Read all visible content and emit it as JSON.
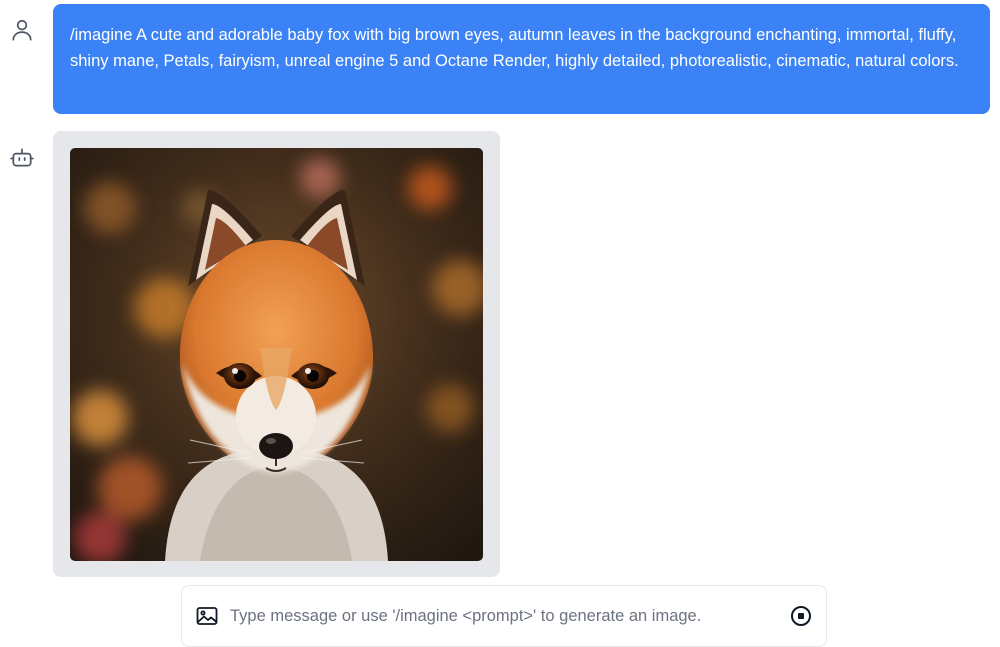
{
  "conversation": {
    "user_message": {
      "avatar_icon": "user-icon",
      "text": "/imagine A cute and adorable baby fox with big brown eyes, autumn leaves in the background enchanting, immortal, fluffy, shiny mane, Petals, fairyism, unreal engine 5 and Octane Render, highly detailed, photorealistic, cinematic, natural colors."
    },
    "bot_message": {
      "avatar_icon": "robot-icon",
      "image_subject": "baby fox with autumn bokeh background"
    }
  },
  "composer": {
    "attach_icon": "image-icon",
    "placeholder": "Type message or use '/imagine <prompt>' to generate an image.",
    "value": "",
    "stop_icon": "stop-circle-icon"
  },
  "colors": {
    "user_bubble": "#3b82f6",
    "bot_bubble": "#e5e7eb",
    "icon": "#4b5563"
  }
}
